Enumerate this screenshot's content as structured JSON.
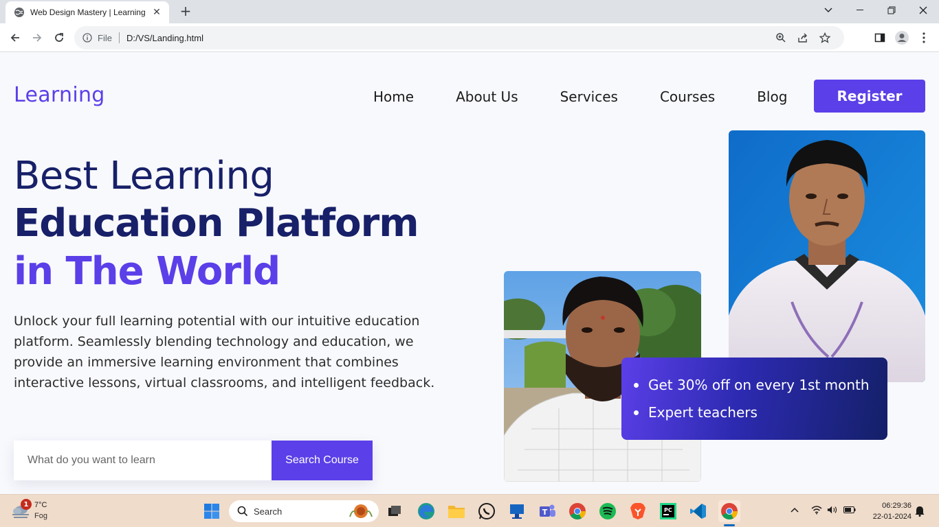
{
  "browser": {
    "tab_title": "Web Design Mastery | Learning Platform",
    "tab_close": "✕",
    "new_tab": "+",
    "file_label": "File",
    "url": "D:/VS/Landing.html"
  },
  "site": {
    "logo": "Learning",
    "nav": [
      "Home",
      "About Us",
      "Services",
      "Courses",
      "Blog"
    ],
    "register": "Register",
    "hero_line1": "Best Learning",
    "hero_line2": "Education Platform",
    "hero_line3": "in The World",
    "description": "Unlock your full learning potential with our intuitive education platform. Seamlessly blending technology and education, we provide an immersive learning environment that combines interactive lessons, virtual classrooms, and intelligent feedback.",
    "search_placeholder": "What do you want to learn",
    "search_button": "Search Course",
    "promo": [
      "Get 30% off on every 1st month",
      "Expert teachers"
    ]
  },
  "taskbar": {
    "notification_count": "1",
    "temperature": "7°C",
    "condition": "Fog",
    "search_label": "Search",
    "time": "06:29:36",
    "date": "22-01-2024"
  },
  "colors": {
    "brand": "#5b3fe8",
    "navy": "#172068",
    "page_bg": "#f8f9fd",
    "taskbar_bg": "#f0dccb"
  }
}
